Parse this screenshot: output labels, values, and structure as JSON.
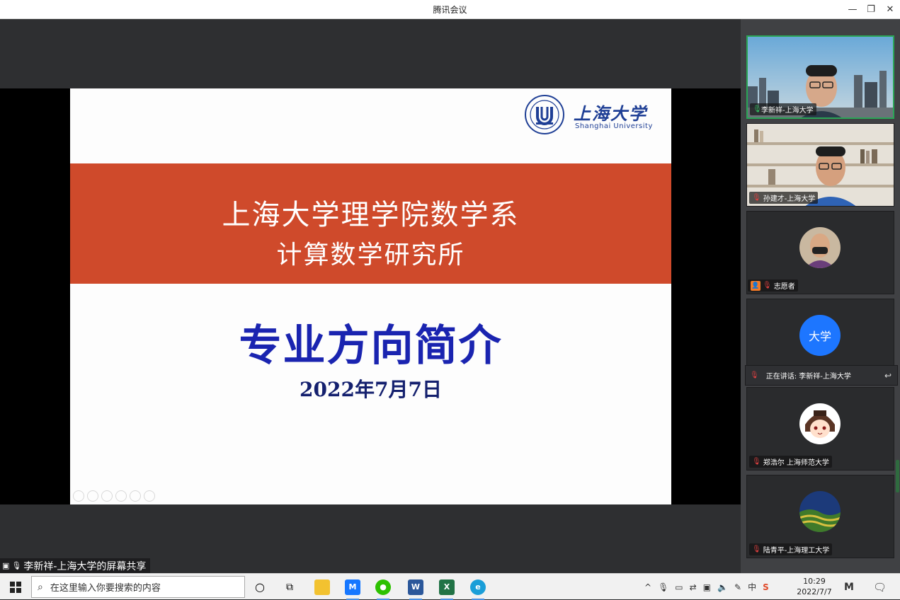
{
  "window": {
    "title": "腾讯会议"
  },
  "slide": {
    "logo_cn": "上海大学",
    "logo_en": "Shanghai University",
    "seal_text": "SHANGHAI UNIVERSITY",
    "band_line1": "上海大学理学院数学系",
    "band_line2": "计算数学研究所",
    "heading": "专业方向简介",
    "date": "2022年7月7日"
  },
  "share_label": "李新祥-上海大学的屏幕共享",
  "participants": [
    {
      "name": "李新祥-上海大学",
      "mic": "on",
      "kind": "video-city"
    },
    {
      "name": "孙建才-上海大学",
      "mic": "off",
      "kind": "video-shelf"
    },
    {
      "name": "志愿者",
      "mic": "off",
      "kind": "avatar-photo"
    },
    {
      "name": "",
      "avatar_text": "大学",
      "mic": "off",
      "kind": "avatar-text"
    },
    {
      "name": "郑浩尔 上海师范大学",
      "mic": "off",
      "kind": "avatar-cartoon"
    },
    {
      "name": "陆青平-上海理工大学",
      "mic": "off",
      "kind": "avatar-landscape"
    }
  ],
  "speaking": {
    "label": "正在讲话: 李新祥-上海大学"
  },
  "taskbar": {
    "search_placeholder": "在这里输入你要搜索的内容",
    "time": "10:29",
    "date": "2022/7/7",
    "ime_label": "中"
  },
  "colors": {
    "band": "#cf4a2b",
    "heading": "#1a24b0",
    "accent": "#2aa556"
  }
}
